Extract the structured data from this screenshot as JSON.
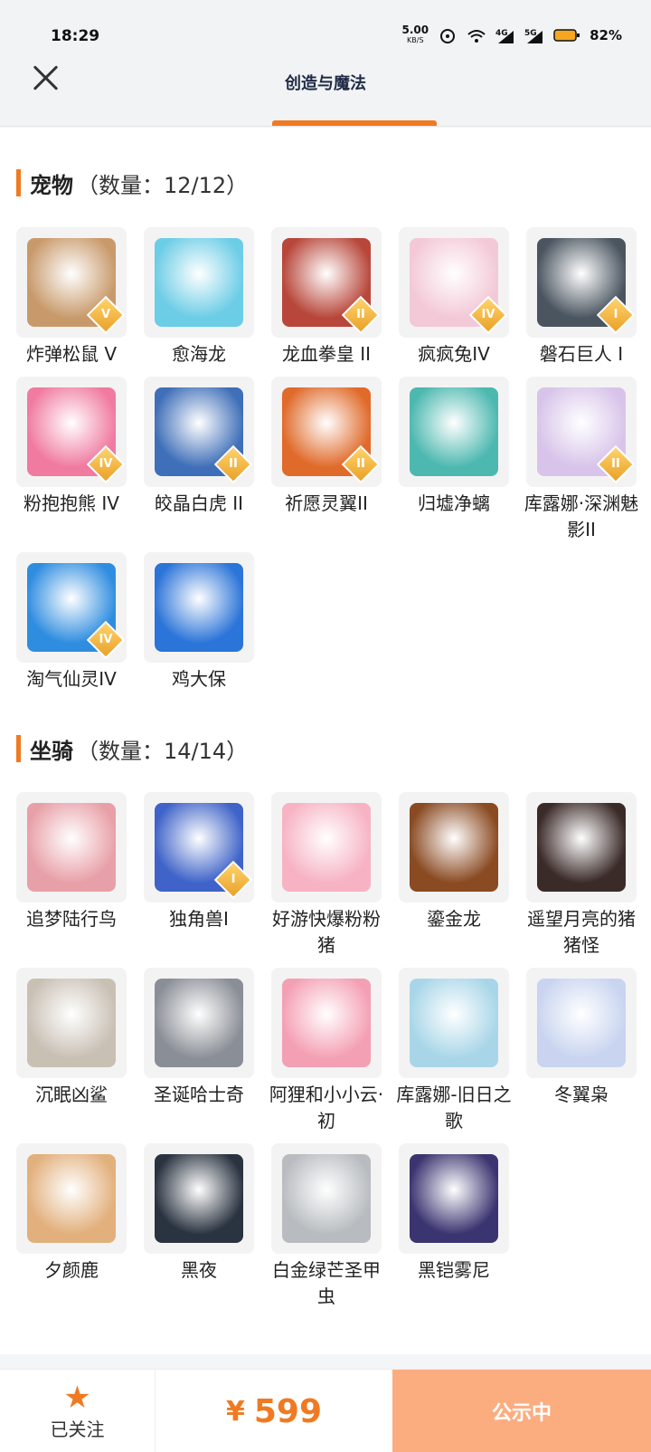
{
  "status_bar": {
    "time": "18:29",
    "net_speed": "5.00",
    "net_unit": "KB/S",
    "signal_1": "4G",
    "signal_2": "5G",
    "battery": "82%"
  },
  "header": {
    "title": "创造与魔法"
  },
  "pets": {
    "title": "宠物",
    "count": "（数量：12/12）",
    "items": [
      {
        "name": "炸弹松鼠 V",
        "tier": "V",
        "color": "#c89a6b"
      },
      {
        "name": "愈海龙",
        "tier": "",
        "color": "#6ccde6"
      },
      {
        "name": "龙血拳皇 II",
        "tier": "II",
        "color": "#b8463a"
      },
      {
        "name": "疯疯兔IV",
        "tier": "IV",
        "color": "#f3c8d7"
      },
      {
        "name": "磐石巨人 I",
        "tier": "I",
        "color": "#4a5560"
      },
      {
        "name": "粉抱抱熊 IV",
        "tier": "IV",
        "color": "#f07aa0"
      },
      {
        "name": "皎晶白虎 II",
        "tier": "II",
        "color": "#3f6fb8"
      },
      {
        "name": "祈愿灵翼II",
        "tier": "II",
        "color": "#e06a2a"
      },
      {
        "name": "归墟净螭",
        "tier": "",
        "color": "#4cb8b0"
      },
      {
        "name": "库露娜·深渊魅影II",
        "tier": "II",
        "color": "#d8c4ea"
      },
      {
        "name": "淘气仙灵IV",
        "tier": "IV",
        "color": "#2f8de0"
      },
      {
        "name": "鸡大保",
        "tier": "",
        "color": "#2b74d8"
      }
    ]
  },
  "mounts": {
    "title": "坐骑",
    "count": "（数量：14/14）",
    "items": [
      {
        "name": "追梦陆行鸟",
        "tier": "",
        "color": "#e8a0a8"
      },
      {
        "name": "独角兽I",
        "tier": "I",
        "color": "#3f63c8"
      },
      {
        "name": "好游快爆粉粉猪",
        "tier": "",
        "color": "#f7b3c4"
      },
      {
        "name": "鎏金龙",
        "tier": "",
        "color": "#8a4a22"
      },
      {
        "name": "遥望月亮的猪猪怪",
        "tier": "",
        "color": "#3a2a28"
      },
      {
        "name": "沉眠凶鲨",
        "tier": "",
        "color": "#c9c0b4"
      },
      {
        "name": "圣诞哈士奇",
        "tier": "",
        "color": "#8a8e96"
      },
      {
        "name": "阿狸和小小云·初",
        "tier": "",
        "color": "#f4a0b4"
      },
      {
        "name": "库露娜-旧日之歌",
        "tier": "",
        "color": "#a8d6e8"
      },
      {
        "name": "冬翼枭",
        "tier": "",
        "color": "#c8d4f0"
      },
      {
        "name": "夕颜鹿",
        "tier": "",
        "color": "#e2b07c"
      },
      {
        "name": "黑夜",
        "tier": "",
        "color": "#2a3340"
      },
      {
        "name": "白金绿芒圣甲虫",
        "tier": "",
        "color": "#b8bcc0"
      },
      {
        "name": "黑铠雾尼",
        "tier": "",
        "color": "#3a3470"
      }
    ]
  },
  "bottom": {
    "follow_label": "已关注",
    "currency": "¥",
    "price": "599",
    "action_label": "公示中"
  },
  "colors": {
    "accent": "#f07a22",
    "action_bg": "#fcad80"
  }
}
